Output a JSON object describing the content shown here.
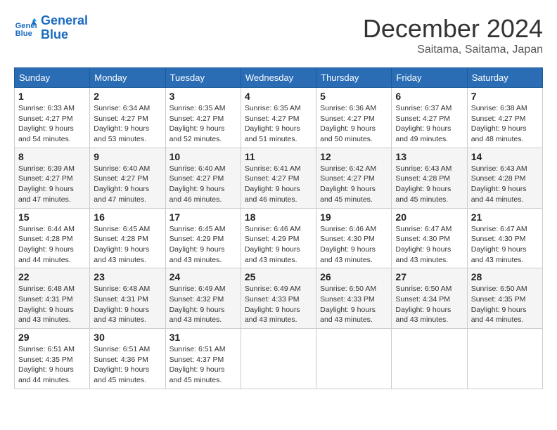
{
  "header": {
    "logo_line1": "General",
    "logo_line2": "Blue",
    "month": "December 2024",
    "location": "Saitama, Saitama, Japan"
  },
  "days_of_week": [
    "Sunday",
    "Monday",
    "Tuesday",
    "Wednesday",
    "Thursday",
    "Friday",
    "Saturday"
  ],
  "weeks": [
    [
      {
        "day": "1",
        "sunrise": "6:33 AM",
        "sunset": "4:27 PM",
        "daylight": "9 hours and 54 minutes."
      },
      {
        "day": "2",
        "sunrise": "6:34 AM",
        "sunset": "4:27 PM",
        "daylight": "9 hours and 53 minutes."
      },
      {
        "day": "3",
        "sunrise": "6:35 AM",
        "sunset": "4:27 PM",
        "daylight": "9 hours and 52 minutes."
      },
      {
        "day": "4",
        "sunrise": "6:35 AM",
        "sunset": "4:27 PM",
        "daylight": "9 hours and 51 minutes."
      },
      {
        "day": "5",
        "sunrise": "6:36 AM",
        "sunset": "4:27 PM",
        "daylight": "9 hours and 50 minutes."
      },
      {
        "day": "6",
        "sunrise": "6:37 AM",
        "sunset": "4:27 PM",
        "daylight": "9 hours and 49 minutes."
      },
      {
        "day": "7",
        "sunrise": "6:38 AM",
        "sunset": "4:27 PM",
        "daylight": "9 hours and 48 minutes."
      }
    ],
    [
      {
        "day": "8",
        "sunrise": "6:39 AM",
        "sunset": "4:27 PM",
        "daylight": "9 hours and 47 minutes."
      },
      {
        "day": "9",
        "sunrise": "6:40 AM",
        "sunset": "4:27 PM",
        "daylight": "9 hours and 47 minutes."
      },
      {
        "day": "10",
        "sunrise": "6:40 AM",
        "sunset": "4:27 PM",
        "daylight": "9 hours and 46 minutes."
      },
      {
        "day": "11",
        "sunrise": "6:41 AM",
        "sunset": "4:27 PM",
        "daylight": "9 hours and 46 minutes."
      },
      {
        "day": "12",
        "sunrise": "6:42 AM",
        "sunset": "4:27 PM",
        "daylight": "9 hours and 45 minutes."
      },
      {
        "day": "13",
        "sunrise": "6:43 AM",
        "sunset": "4:28 PM",
        "daylight": "9 hours and 45 minutes."
      },
      {
        "day": "14",
        "sunrise": "6:43 AM",
        "sunset": "4:28 PM",
        "daylight": "9 hours and 44 minutes."
      }
    ],
    [
      {
        "day": "15",
        "sunrise": "6:44 AM",
        "sunset": "4:28 PM",
        "daylight": "9 hours and 44 minutes."
      },
      {
        "day": "16",
        "sunrise": "6:45 AM",
        "sunset": "4:28 PM",
        "daylight": "9 hours and 43 minutes."
      },
      {
        "day": "17",
        "sunrise": "6:45 AM",
        "sunset": "4:29 PM",
        "daylight": "9 hours and 43 minutes."
      },
      {
        "day": "18",
        "sunrise": "6:46 AM",
        "sunset": "4:29 PM",
        "daylight": "9 hours and 43 minutes."
      },
      {
        "day": "19",
        "sunrise": "6:46 AM",
        "sunset": "4:30 PM",
        "daylight": "9 hours and 43 minutes."
      },
      {
        "day": "20",
        "sunrise": "6:47 AM",
        "sunset": "4:30 PM",
        "daylight": "9 hours and 43 minutes."
      },
      {
        "day": "21",
        "sunrise": "6:47 AM",
        "sunset": "4:30 PM",
        "daylight": "9 hours and 43 minutes."
      }
    ],
    [
      {
        "day": "22",
        "sunrise": "6:48 AM",
        "sunset": "4:31 PM",
        "daylight": "9 hours and 43 minutes."
      },
      {
        "day": "23",
        "sunrise": "6:48 AM",
        "sunset": "4:31 PM",
        "daylight": "9 hours and 43 minutes."
      },
      {
        "day": "24",
        "sunrise": "6:49 AM",
        "sunset": "4:32 PM",
        "daylight": "9 hours and 43 minutes."
      },
      {
        "day": "25",
        "sunrise": "6:49 AM",
        "sunset": "4:33 PM",
        "daylight": "9 hours and 43 minutes."
      },
      {
        "day": "26",
        "sunrise": "6:50 AM",
        "sunset": "4:33 PM",
        "daylight": "9 hours and 43 minutes."
      },
      {
        "day": "27",
        "sunrise": "6:50 AM",
        "sunset": "4:34 PM",
        "daylight": "9 hours and 43 minutes."
      },
      {
        "day": "28",
        "sunrise": "6:50 AM",
        "sunset": "4:35 PM",
        "daylight": "9 hours and 44 minutes."
      }
    ],
    [
      {
        "day": "29",
        "sunrise": "6:51 AM",
        "sunset": "4:35 PM",
        "daylight": "9 hours and 44 minutes."
      },
      {
        "day": "30",
        "sunrise": "6:51 AM",
        "sunset": "4:36 PM",
        "daylight": "9 hours and 45 minutes."
      },
      {
        "day": "31",
        "sunrise": "6:51 AM",
        "sunset": "4:37 PM",
        "daylight": "9 hours and 45 minutes."
      },
      null,
      null,
      null,
      null
    ]
  ],
  "labels": {
    "sunrise": "Sunrise:",
    "sunset": "Sunset:",
    "daylight": "Daylight:"
  }
}
